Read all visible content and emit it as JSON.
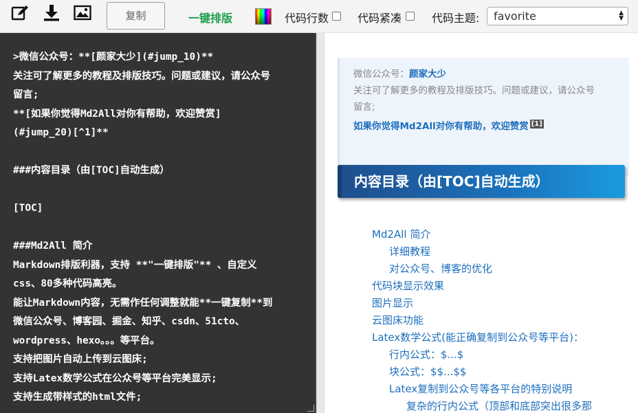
{
  "toolbar": {
    "copy_label": "复制",
    "onekey_label": "一键排版",
    "line_numbers_label": "代码行数",
    "compact_label": "代码紧凑",
    "theme_label": "代码主题:",
    "theme_value": "favorite",
    "onekey_color": "#1e9e4b"
  },
  "editor": {
    "lines": [
      ">微信公众号：**[颜家大少](#jump_10)**",
      "关注可了解更多的教程及排版技巧。问题或建议，请公众号",
      "留言;",
      "**[如果你觉得Md2All对你有帮助，欢迎赞赏]",
      "(#jump_20)[^1]**",
      "",
      "###内容目录（由[TOC]自动生成）",
      "",
      "[TOC]",
      "",
      "###Md2All 简介",
      "Markdown排版利器，支持 **\"一键排版\"** 、自定义",
      "css、80多种代码高亮。",
      "能让Markdown内容，无需作任何调整就能**一键复制**到",
      "微信公众号、博客园、掘金、知乎、csdn、51cto、",
      "wordpress、hexo。。。等平台。",
      "支持把图片自动上传到云图床;",
      "支持Latex数学公式在公众号等平台完美显示;",
      "支持生成带样式的html文件;"
    ]
  },
  "preview": {
    "quote": {
      "prefix": "微信公众号：",
      "name": "颜家大少",
      "line2a": "关注可了解更多的教程及排版技巧。问题或建议，请公众号",
      "line2b": "留言;",
      "line3": "如果你觉得Md2All对你有帮助，欢迎赞赏",
      "footnote": "[1]"
    },
    "toc_title": "内容目录（由[TOC]自动生成）",
    "toc_items": [
      "Md2All 简介",
      "详细教程",
      "对公众号、博客的优化",
      "代码块显示效果",
      "图片显示",
      "云图床功能",
      "Latex数学公式(能正确复制到公众号等平台)：",
      "行内公式：$...$",
      "块公式：$$...$$",
      "Latex复制到公众号等各平台的特别说明",
      "复杂的行内公式（顶部和底部突出很多那"
    ],
    "link_color": "#1d6fbd"
  }
}
